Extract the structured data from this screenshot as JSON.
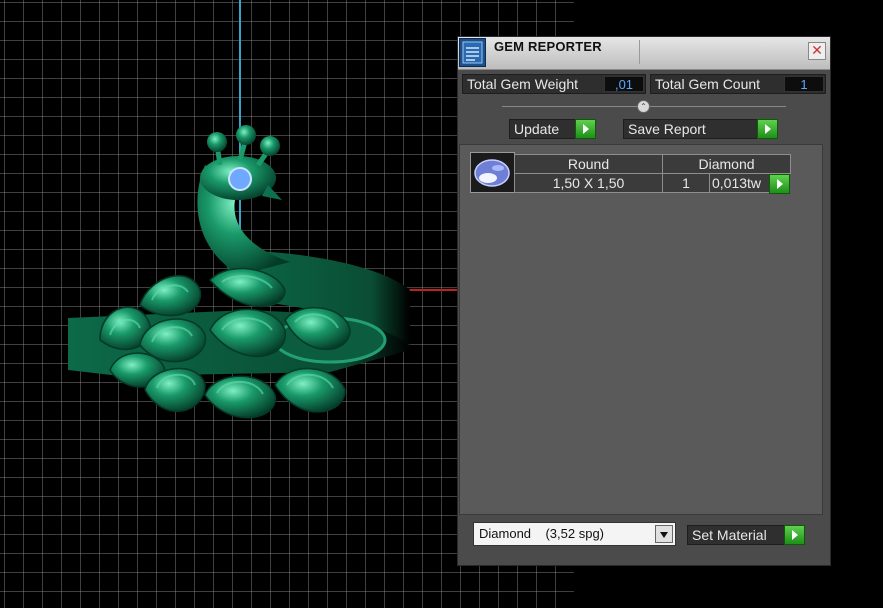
{
  "viewport": {
    "name": "3D viewport"
  },
  "panel": {
    "title": "GEM REPORTER",
    "close_glyph": "✕",
    "total_weight_label": "Total Gem Weight",
    "total_weight_value": ",01",
    "total_count_label": "Total Gem Count",
    "total_count_value": "1",
    "slider_glyph": "⌃",
    "update_label": "Update",
    "save_report_label": "Save Report",
    "gems": [
      {
        "shape": "Round",
        "material": "Diamond",
        "size": "1,50 X 1,50",
        "count": "1",
        "weight": "0,013tw"
      }
    ],
    "material_select": "Diamond    (3,52 spg)",
    "set_material_label": "Set Material",
    "accent_color": "#2f9e1f",
    "value_color": "#5aa8ff"
  },
  "icons": [
    "gem-reporter-app-icon",
    "close-icon",
    "play-icon",
    "gem-thumbnail-icon",
    "dropdown-arrow-icon"
  ]
}
